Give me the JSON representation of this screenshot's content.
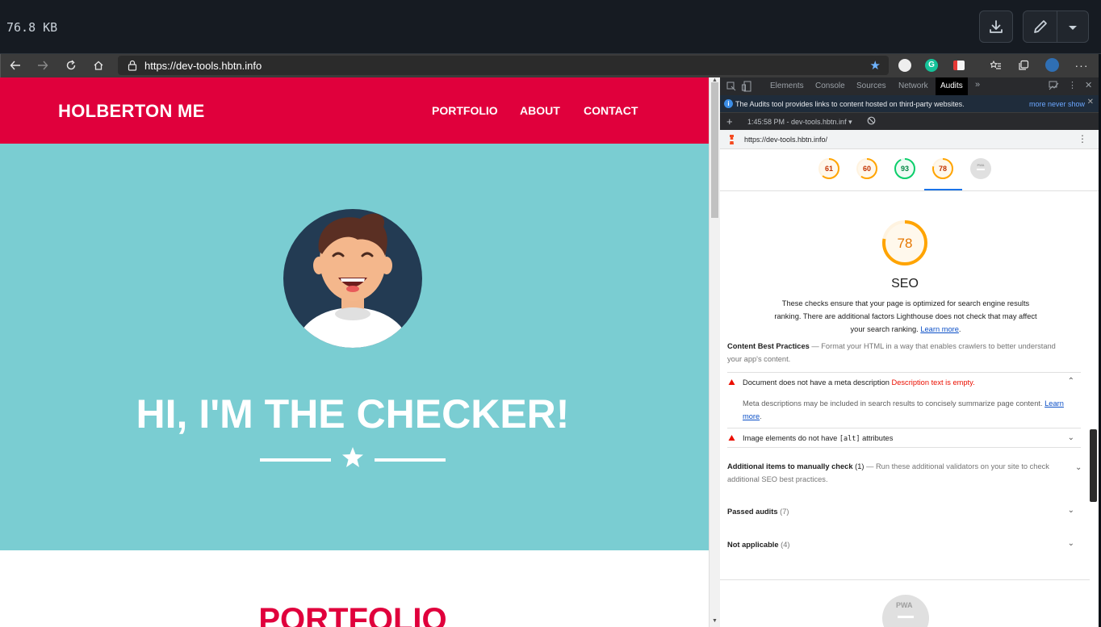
{
  "viewer": {
    "file_size": "76.8 KB"
  },
  "browser": {
    "url": "https://dev-tools.hbtn.info"
  },
  "site": {
    "title": "HOLBERTON ME",
    "nav": [
      "PORTFOLIO",
      "ABOUT",
      "CONTACT"
    ],
    "hero_title": "HI, I'M THE CHECKER!",
    "portfolio_title": "PORTFOLIO",
    "colors": {
      "header": "#e0003c",
      "hero": "#7acdd2"
    }
  },
  "devtools": {
    "tabs": [
      "Elements",
      "Console",
      "Sources",
      "Network",
      "Audits"
    ],
    "active_tab": "Audits",
    "notice": "The Audits tool provides links to content hosted on third-party websites.",
    "notice_link": "more never show",
    "session": "1:45:58 PM - dev-tools.hbtn.inf ▾",
    "report_url": "https://dev-tools.hbtn.info/",
    "scores": [
      {
        "value": "61",
        "color": "#ffa400"
      },
      {
        "value": "60",
        "color": "#ffa400"
      },
      {
        "value": "93",
        "color": "#0cce6b"
      },
      {
        "value": "78",
        "color": "#ffa400"
      },
      {
        "value": "PWA",
        "color": "#9e9e9e"
      }
    ],
    "seo": {
      "score": "78",
      "score_fraction": 0.78,
      "title": "SEO",
      "description": "These checks ensure that your page is optimized for search engine results ranking. There are additional factors Lighthouse does not check that may affect your search ranking.",
      "learn_more": "Learn more"
    },
    "content_best": {
      "title": "Content Best Practices",
      "desc": "— Format your HTML in a way that enables crawlers to better understand your app's content."
    },
    "audit1": {
      "title": "Document does not have a meta description",
      "error": "Description text is empty.",
      "detail": "Meta descriptions may be included in search results to concisely summarize page content.",
      "learn": "Learn more"
    },
    "audit2": {
      "title_pre": "Image elements do not have",
      "code": "[alt]",
      "title_post": "attributes"
    },
    "manual": {
      "title": "Additional items to manually check",
      "count": "(1)",
      "desc": "— Run these additional validators on your site to check additional SEO best practices."
    },
    "passed": {
      "title": "Passed audits",
      "count": "(7)"
    },
    "not_applicable": {
      "title": "Not applicable",
      "count": "(4)"
    },
    "pwa_label": "PWA"
  }
}
